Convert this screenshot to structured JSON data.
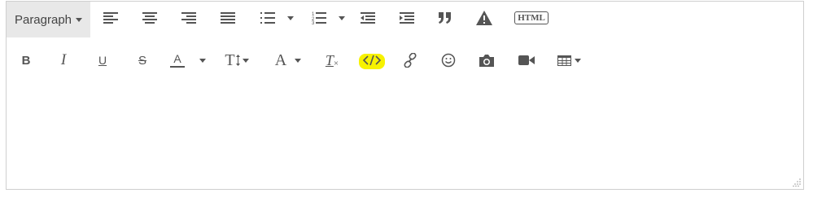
{
  "toolbar": {
    "paragraph_label": "Paragraph",
    "html_label": "HTML",
    "bold_label": "B",
    "italic_label": "I",
    "underline_label": "U",
    "strike_label": "S",
    "font_color_label": "A",
    "font_size_label": "T",
    "font_family_label": "A",
    "clear_format_label": "T",
    "row1_icons": [
      "align-left-icon",
      "align-center-icon",
      "align-right-icon",
      "align-justify-icon",
      "bullet-list-icon",
      "numbered-list-icon",
      "outdent-icon",
      "indent-icon",
      "quote-icon",
      "warning-icon",
      "html-icon"
    ],
    "row2_icons": [
      "bold-icon",
      "italic-icon",
      "underline-icon",
      "strikethrough-icon",
      "font-color-icon",
      "font-size-icon",
      "font-family-icon",
      "clear-format-icon",
      "code-icon",
      "link-icon",
      "emoji-icon",
      "camera-icon",
      "video-icon",
      "table-icon"
    ],
    "highlight_color": "#f7f200"
  },
  "editor": {
    "content": ""
  }
}
